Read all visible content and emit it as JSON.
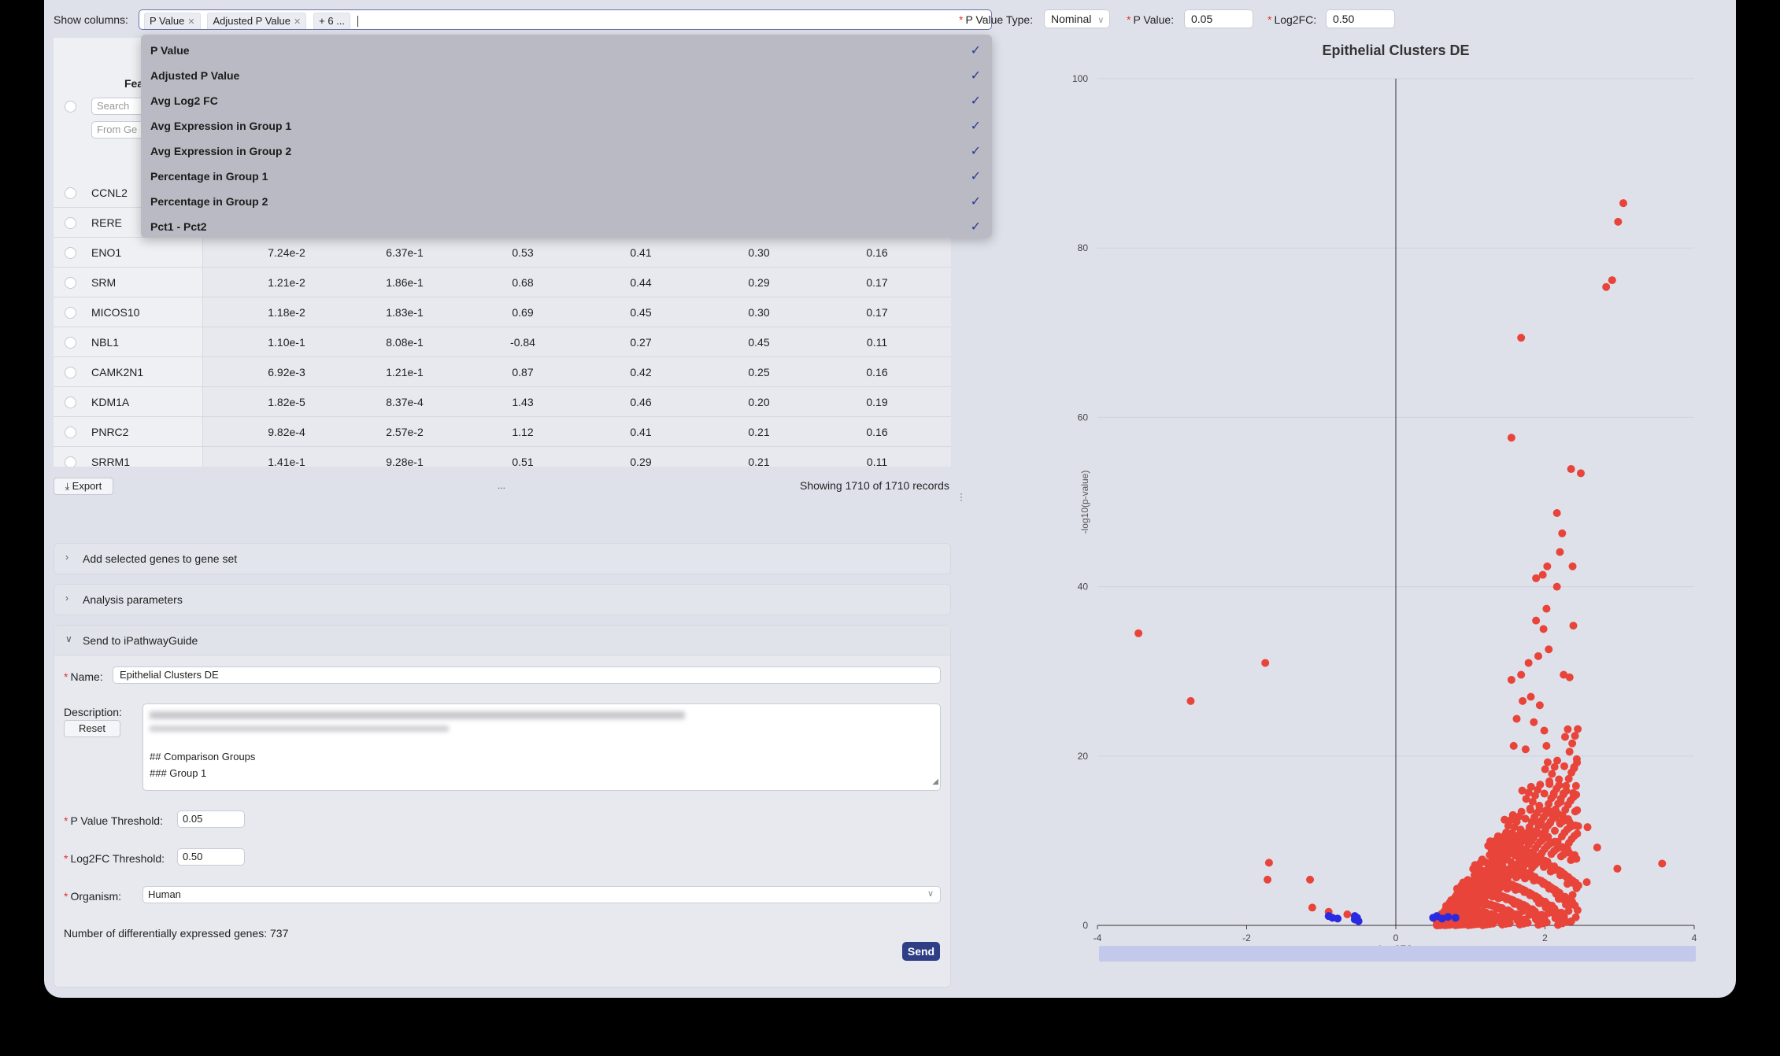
{
  "toolbar": {
    "show_columns_label": "Show columns",
    "selected_tags": [
      "P Value",
      "Adjusted P Value"
    ],
    "more_tag": "+ 6 ...",
    "pvalue_type_label": "P Value Type",
    "pvalue_type_value": "Nominal",
    "pvalue_label": "P Value",
    "pvalue_value": "0.05",
    "log2fc_label": "Log2FC",
    "log2fc_value": "0.50"
  },
  "column_options": [
    "P Value",
    "Adjusted P Value",
    "Avg Log2 FC",
    "Avg Expression in Group 1",
    "Avg Expression in Group 2",
    "Percentage in Group 1",
    "Percentage in Group 2",
    "Pct1 - Pct2"
  ],
  "table": {
    "feature_header_partial": "Fea",
    "search_placeholder": "Search",
    "from_placeholder": "From Ge",
    "hidden_rows": [
      "CCNL2",
      "RERE"
    ],
    "rows": [
      {
        "gene": "ENO1",
        "cells": [
          "7.24e-2",
          "6.37e-1",
          "0.53",
          "0.41",
          "0.30",
          "0.16"
        ]
      },
      {
        "gene": "SRM",
        "cells": [
          "1.21e-2",
          "1.86e-1",
          "0.68",
          "0.44",
          "0.29",
          "0.17"
        ]
      },
      {
        "gene": "MICOS10",
        "cells": [
          "1.18e-2",
          "1.83e-1",
          "0.69",
          "0.45",
          "0.30",
          "0.17"
        ]
      },
      {
        "gene": "NBL1",
        "cells": [
          "1.10e-1",
          "8.08e-1",
          "-0.84",
          "0.27",
          "0.45",
          "0.11"
        ]
      },
      {
        "gene": "CAMK2N1",
        "cells": [
          "6.92e-3",
          "1.21e-1",
          "0.87",
          "0.42",
          "0.25",
          "0.16"
        ]
      },
      {
        "gene": "KDM1A",
        "cells": [
          "1.82e-5",
          "8.37e-4",
          "1.43",
          "0.46",
          "0.20",
          "0.19"
        ]
      },
      {
        "gene": "PNRC2",
        "cells": [
          "9.82e-4",
          "2.57e-2",
          "1.12",
          "0.41",
          "0.21",
          "0.16"
        ]
      },
      {
        "gene": "SRRM1",
        "cells": [
          "1.41e-1",
          "9.28e-1",
          "0.51",
          "0.29",
          "0.21",
          "0.11"
        ]
      }
    ]
  },
  "export_label": "Export",
  "ellipsis": "...",
  "records_text": "Showing 1710 of 1710 records",
  "panels": {
    "add_genes": "Add selected genes to gene set",
    "analysis": "Analysis parameters",
    "send": "Send to iPathwayGuide"
  },
  "form": {
    "name_label": "Name",
    "name_value": "Epithelial Clusters DE",
    "description_label": "Description",
    "reset_label": "Reset",
    "desc_line1": "## Comparison Groups",
    "desc_line2": "### Group 1",
    "pval_threshold_label": "P Value Threshold",
    "pval_threshold_value": "0.05",
    "log2fc_threshold_label": "Log2FC Threshold",
    "log2fc_threshold_value": "0.50",
    "organism_label": "Organism",
    "organism_value": "Human",
    "de_count_text": "Number of differentially expressed genes: 737",
    "send_label": "Send"
  },
  "colors": {
    "up": "#e8443a",
    "down": "#2a2ae0",
    "accent": "#2e3f86"
  },
  "chart_data": {
    "type": "scatter",
    "title": "Epithelial Clusters DE",
    "xlabel": "Log2FC",
    "ylabel": "-log10(p-value)",
    "xlim": [
      -4,
      4
    ],
    "ylim": [
      0,
      100
    ],
    "xticks": [
      "-4",
      "-2",
      "0",
      "2",
      "4"
    ],
    "yticks": [
      "0",
      "20",
      "40",
      "60",
      "80",
      "100"
    ],
    "series": [
      {
        "color": "#e8443a",
        "points": [
          [
            -3.45,
            34.5
          ],
          [
            -2.75,
            26.5
          ],
          [
            -1.75,
            31
          ],
          [
            -1.7,
            7.4
          ],
          [
            -1.72,
            5.4
          ],
          [
            -1.15,
            5.4
          ],
          [
            -1.12,
            2.1
          ],
          [
            -0.9,
            1.6
          ],
          [
            -0.65,
            1.3
          ],
          [
            3.05,
            85.3
          ],
          [
            2.98,
            83.1
          ],
          [
            2.9,
            76.2
          ],
          [
            2.82,
            75.4
          ],
          [
            1.68,
            69.4
          ],
          [
            1.55,
            57.6
          ],
          [
            2.35,
            53.9
          ],
          [
            2.48,
            53.4
          ],
          [
            2.16,
            48.7
          ],
          [
            2.23,
            46.3
          ],
          [
            2.2,
            44.1
          ],
          [
            2.37,
            42.4
          ],
          [
            2.03,
            42.4
          ],
          [
            1.97,
            41.4
          ],
          [
            1.88,
            41.0
          ],
          [
            2.16,
            40.0
          ],
          [
            2.02,
            37.4
          ],
          [
            1.88,
            36.0
          ],
          [
            1.98,
            35.0
          ],
          [
            2.38,
            35.4
          ],
          [
            1.91,
            31.8
          ],
          [
            2.05,
            32.6
          ],
          [
            1.78,
            31.0
          ],
          [
            1.68,
            29.6
          ],
          [
            1.55,
            29.0
          ],
          [
            2.25,
            29.6
          ],
          [
            2.33,
            29.3
          ],
          [
            1.81,
            27.0
          ],
          [
            1.7,
            26.5
          ],
          [
            1.93,
            26.0
          ],
          [
            1.62,
            24.4
          ],
          [
            1.85,
            24.0
          ],
          [
            1.99,
            23.0
          ],
          [
            1.58,
            21.2
          ],
          [
            1.74,
            20.8
          ],
          [
            2.02,
            21.2
          ],
          [
            2.43,
            13.6
          ],
          [
            2.57,
            11.6
          ],
          [
            2.7,
            9.2
          ],
          [
            2.97,
            6.7
          ],
          [
            3.57,
            7.3
          ],
          [
            2.56,
            5.1
          ],
          [
            2.3,
            4.9
          ],
          [
            2.37,
            3.6
          ]
        ]
      },
      {
        "color": "#2a2ae0",
        "points": [
          [
            -0.9,
            1.1
          ],
          [
            -0.85,
            0.9
          ],
          [
            -0.78,
            0.8
          ],
          [
            -0.55,
            0.7
          ],
          [
            -0.52,
            0.9
          ],
          [
            -0.5,
            0.5
          ],
          [
            -0.55,
            1.1
          ],
          [
            0.5,
            0.9
          ],
          [
            0.55,
            1.1
          ],
          [
            0.62,
            0.8
          ],
          [
            0.7,
            1.0
          ],
          [
            0.8,
            0.9
          ]
        ]
      }
    ]
  }
}
